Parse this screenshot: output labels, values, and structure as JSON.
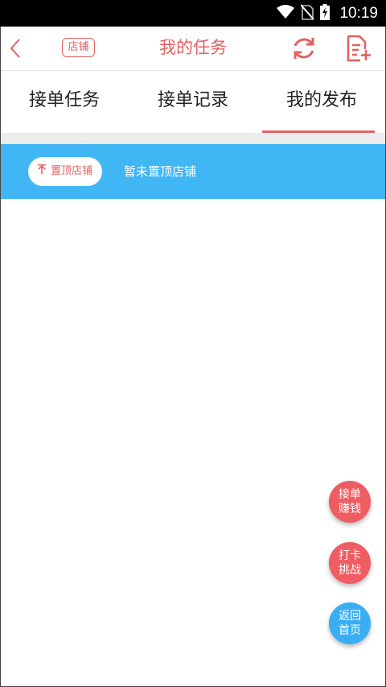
{
  "status": {
    "time": "10:19"
  },
  "header": {
    "shop_label": "店铺",
    "title": "我的任务"
  },
  "tabs": [
    {
      "label": "接单任务",
      "active": false
    },
    {
      "label": "接单记录",
      "active": false
    },
    {
      "label": "我的发布",
      "active": true
    }
  ],
  "pin": {
    "button_label": "置顶店铺",
    "status_text": "暂未置顶店铺"
  },
  "float_buttons": [
    {
      "line1": "接单",
      "line2": "赚钱"
    },
    {
      "line1": "打卡",
      "line2": "挑战"
    },
    {
      "line1": "返回",
      "line2": "首页"
    }
  ],
  "colors": {
    "accent": "#e3605f",
    "pin_bar": "#40b6f5",
    "float_red": "#ef5d63",
    "float_blue": "#3aaef2"
  },
  "icons": [
    "wifi-icon",
    "no-sim-icon",
    "battery-charging-icon",
    "back-chevron-icon",
    "refresh-icon",
    "add-document-icon",
    "arrow-up-icon"
  ]
}
